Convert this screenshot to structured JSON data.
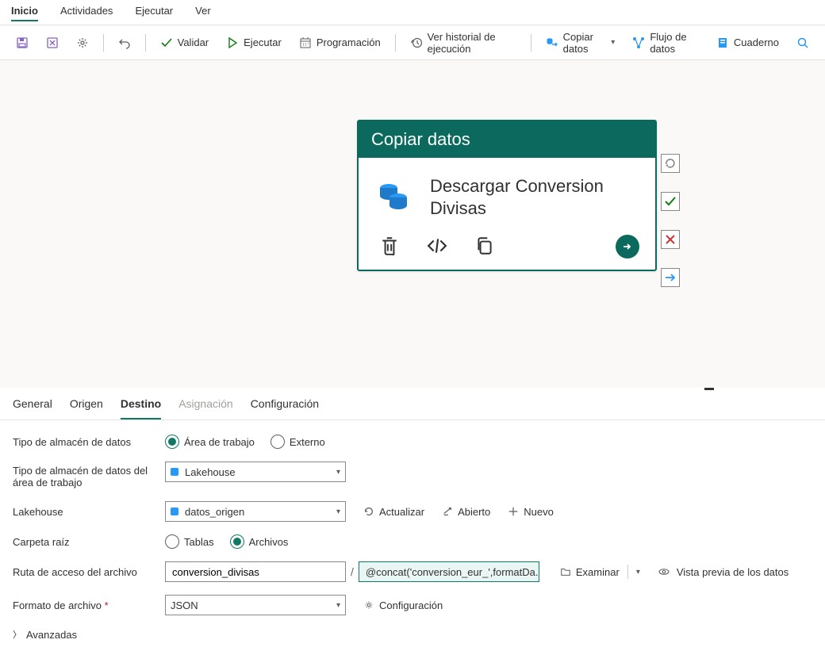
{
  "menu": {
    "items": [
      "Inicio",
      "Actividades",
      "Ejecutar",
      "Ver"
    ],
    "active_index": 0
  },
  "toolbar": {
    "validate": "Validar",
    "run": "Ejecutar",
    "schedule": "Programación",
    "history": "Ver historial de ejecución",
    "copy_data": "Copiar datos",
    "dataflow": "Flujo de datos",
    "notebook": "Cuaderno"
  },
  "activity": {
    "header": "Copiar datos",
    "title": "Descargar Conversion Divisas"
  },
  "tabs": {
    "general": "General",
    "source": "Origen",
    "destination": "Destino",
    "mapping": "Asignación",
    "config": "Configuración",
    "active": "Destino"
  },
  "form": {
    "store_type_label": "Tipo de almacén de datos",
    "store_type_options": {
      "workspace": "Área de trabajo",
      "external": "Externo"
    },
    "store_type_value": "workspace",
    "ws_store_type_label": "Tipo de almacén de datos del área de trabajo",
    "ws_store_type_value": "Lakehouse",
    "lakehouse_label": "Lakehouse",
    "lakehouse_value": "datos_origen",
    "lakehouse_actions": {
      "refresh": "Actualizar",
      "open": "Abierto",
      "new": "Nuevo"
    },
    "root_folder_label": "Carpeta raíz",
    "root_folder_options": {
      "tables": "Tablas",
      "files": "Archivos"
    },
    "root_folder_value": "files",
    "file_path_label": "Ruta de acceso del archivo",
    "file_path_dir": "conversion_divisas",
    "file_path_expr": "@concat('conversion_eur_',formatDa...",
    "browse": "Examinar",
    "preview": "Vista previa de los datos",
    "file_format_label": "Formato de archivo",
    "file_format_value": "JSON",
    "file_format_config": "Configuración",
    "advanced": "Avanzadas"
  },
  "colors": {
    "accent": "#117865",
    "highlight_bg": "#eaf6f3"
  }
}
